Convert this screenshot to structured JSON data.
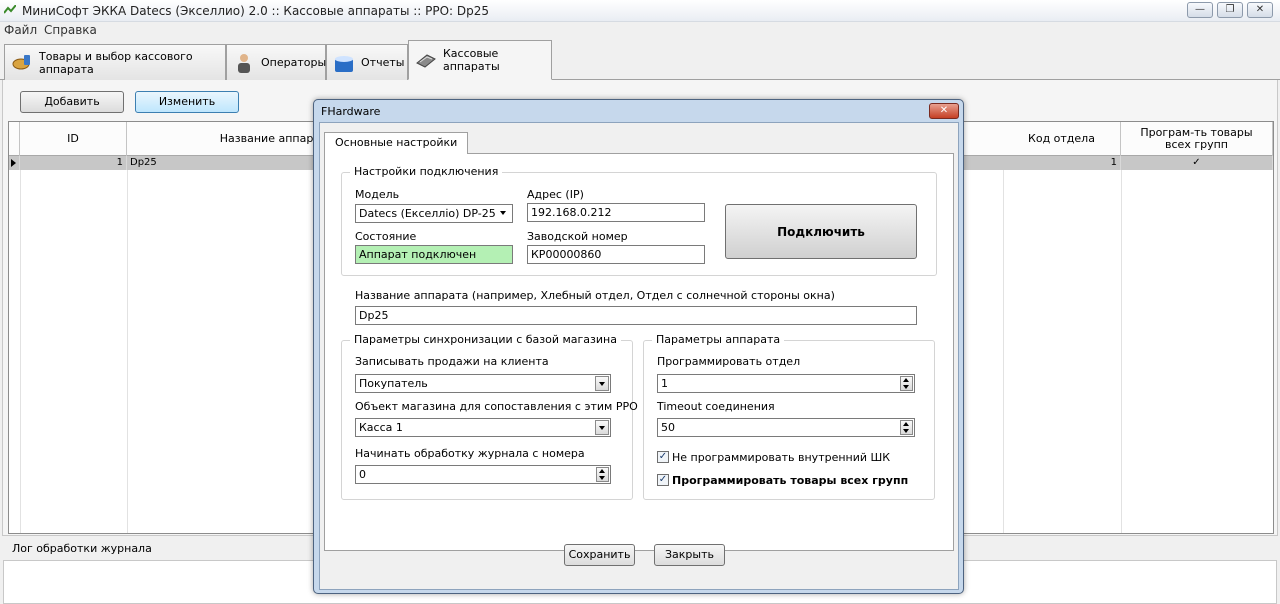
{
  "window": {
    "title": "МиниСофт ЭККА Datecs (Экселлио) 2.0  :: Кассовые аппараты  ::  РРО:  Dp25",
    "minimize": "—",
    "maximize": "❐",
    "close": "✕"
  },
  "menu": [
    "Файл",
    "Справка"
  ],
  "tabs": [
    {
      "label": "Товары и выбор кассового аппарата",
      "icon": "bread-icon"
    },
    {
      "label": "Операторы",
      "icon": "person-icon"
    },
    {
      "label": "Отчеты",
      "icon": "box-icon"
    },
    {
      "label": "Кассовые аппараты",
      "icon": "cash-register-icon",
      "active": true
    }
  ],
  "toolbar": {
    "add_label": "Добавить",
    "edit_label": "Изменить"
  },
  "grid": {
    "columns": [
      "ID",
      "Название аппарата",
      "Код отдела",
      "Програм-ть товары всех групп"
    ],
    "rows": [
      {
        "id": "1",
        "name": "Dp25",
        "dept_code": "1",
        "program_all": "✓"
      }
    ]
  },
  "log": {
    "label": "Лог обработки журнала"
  },
  "dialog": {
    "title": "FHardware",
    "close": "✕",
    "tab": "Основные настройки",
    "connection": {
      "group": "Настройки подключения",
      "model_label": "Модель",
      "model_value": "Datecs (Екселліо) DP-25",
      "address_label": "Адрес (IP)",
      "address_value": "192.168.0.212",
      "state_label": "Состояние",
      "state_value": "Аппарат подключен",
      "serial_label": "Заводской номер",
      "serial_value": "КР00000860",
      "connect_button": "Подключить"
    },
    "device_name": {
      "label": "Название аппарата (например, Хлебный отдел, Отдел с солнечной стороны окна)",
      "value": "Dp25"
    },
    "sync": {
      "group": "Параметры синхронизации с базой магазина",
      "sales_label": "Записывать продажи на клиента",
      "sales_value": "Покупатель",
      "object_label": "Объект магазина для сопоставления с  этим РРО",
      "object_value": "Касса 1",
      "journal_label": "Начинать обработку журнала с номера",
      "journal_value": "0"
    },
    "device": {
      "group": "Параметры аппарата",
      "dept_label": "Программировать отдел",
      "dept_value": "1",
      "timeout_label": "Timeout соединения",
      "timeout_value": "50",
      "no_barcode_label": "Не программировать внутренний ШК",
      "no_barcode_checked": "✓",
      "program_all_label": "Программировать товары всех групп",
      "program_all_checked": "✓"
    },
    "save_button": "Сохранить",
    "close_button": "Закрыть"
  }
}
